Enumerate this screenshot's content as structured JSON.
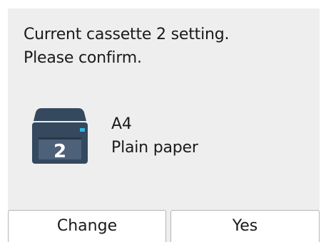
{
  "message": {
    "line1": "Current cassette 2 setting.",
    "line2": "Please confirm."
  },
  "cassette": {
    "icon": "printer-cassette-icon",
    "number": "2",
    "body_color": "#34495e",
    "indicator_color": "#2fb6e6"
  },
  "paper": {
    "size": "A4",
    "type": "Plain paper"
  },
  "buttons": {
    "change_label": "Change",
    "yes_label": "Yes"
  }
}
